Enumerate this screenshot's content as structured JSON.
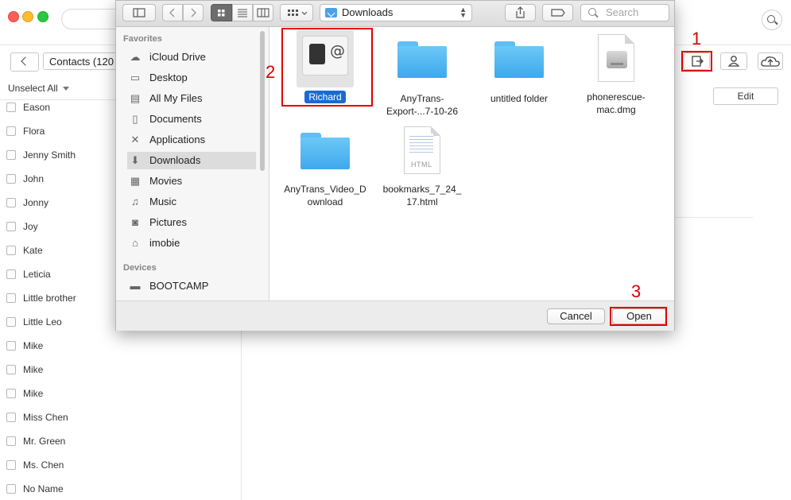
{
  "app": {
    "contacts_button": "Contacts (120",
    "unselect_all": "Unselect All",
    "edit_label": "Edit",
    "contacts": [
      "Eason",
      "Flora",
      "Jenny Smith",
      "John",
      "Jonny",
      "Joy",
      "Kate",
      "Leticia",
      "Little brother",
      "Little Leo",
      "Mike",
      "Mike",
      "Mike",
      "Miss Chen",
      "Mr. Green",
      "Ms. Chen",
      "No Name"
    ]
  },
  "dialog": {
    "location": "Downloads",
    "search_placeholder": "Search",
    "sidebar": {
      "favorites_header": "Favorites",
      "favorites": [
        {
          "label": "iCloud Drive",
          "icon": "cloud-icon"
        },
        {
          "label": "Desktop",
          "icon": "desktop-icon"
        },
        {
          "label": "All My Files",
          "icon": "all-files-icon"
        },
        {
          "label": "Documents",
          "icon": "documents-icon"
        },
        {
          "label": "Applications",
          "icon": "applications-icon"
        },
        {
          "label": "Downloads",
          "icon": "downloads-icon",
          "selected": true
        },
        {
          "label": "Movies",
          "icon": "movies-icon"
        },
        {
          "label": "Music",
          "icon": "music-icon"
        },
        {
          "label": "Pictures",
          "icon": "pictures-icon"
        },
        {
          "label": "imobie",
          "icon": "home-icon"
        }
      ],
      "devices_header": "Devices",
      "devices": [
        {
          "label": "BOOTCAMP",
          "icon": "drive-icon"
        }
      ]
    },
    "files": [
      {
        "line1": "Richard",
        "line2": "",
        "kind": "vcard",
        "selected": true
      },
      {
        "line1": "AnyTrans-",
        "line2": "Export-...7-10-26",
        "kind": "folder"
      },
      {
        "line1": "untitled folder",
        "line2": "",
        "kind": "folder"
      },
      {
        "line1": "phonerescue-",
        "line2": "mac.dmg",
        "kind": "dmg"
      },
      {
        "line1": "AnyTrans_Video_D",
        "line2": "ownload",
        "kind": "folder"
      },
      {
        "line1": "bookmarks_7_24_",
        "line2": "17.html",
        "kind": "html",
        "tag": "HTML"
      }
    ],
    "cancel_label": "Cancel",
    "open_label": "Open"
  },
  "annotations": {
    "step1": "1",
    "step2": "2",
    "step3": "3",
    "color": "#e00000"
  }
}
